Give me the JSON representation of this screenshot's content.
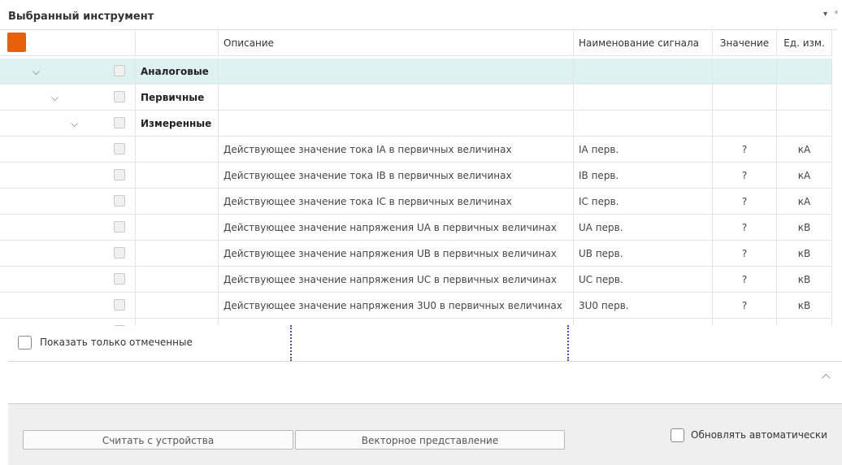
{
  "panel": {
    "title": "Выбранный инструмент",
    "pin_glyph": "▾",
    "dock_glyph": "ᵃ"
  },
  "columns": {
    "description": "Описание",
    "signal": "Наименование сигнала",
    "value": "Значение",
    "unit": "Ед. изм."
  },
  "groups": {
    "analog": "Аналоговые",
    "primary": "Первичные",
    "measured": "Измеренные"
  },
  "rows": [
    {
      "description": "Действующее значение тока IA в первичных величинах",
      "signal": "IA перв.",
      "value": "?",
      "unit": "кА"
    },
    {
      "description": "Действующее значение тока IB в первичных величинах",
      "signal": "IB перв.",
      "value": "?",
      "unit": "кА"
    },
    {
      "description": "Действующее значение тока IC в первичных величинах",
      "signal": "IC перв.",
      "value": "?",
      "unit": "кА"
    },
    {
      "description": "Действующее значение напряжения UA в первичных величинах",
      "signal": "UA перв.",
      "value": "?",
      "unit": "кВ"
    },
    {
      "description": "Действующее значение напряжения UB в первичных величинах",
      "signal": "UB перв.",
      "value": "?",
      "unit": "кВ"
    },
    {
      "description": "Действующее значение напряжения UC в первичных величинах",
      "signal": "UC перв.",
      "value": "?",
      "unit": "кВ"
    },
    {
      "description": "Действующее значение напряжения 3U0 в первичных величинах",
      "signal": "3U0 перв.",
      "value": "?",
      "unit": "кВ"
    }
  ],
  "show_checked_only": "Показать только отмеченные",
  "buttons": {
    "read": "Считать с устройства",
    "vector": "Векторное представление"
  },
  "auto_update": "Обновлять автоматически",
  "colors": {
    "accent": "#e8600a",
    "highlight_row": "#dff2f3",
    "splitter_dots": "#3d4fd6"
  },
  "icons": {
    "expand": "chevron-down-icon",
    "collapse": "chevron-up-icon"
  }
}
